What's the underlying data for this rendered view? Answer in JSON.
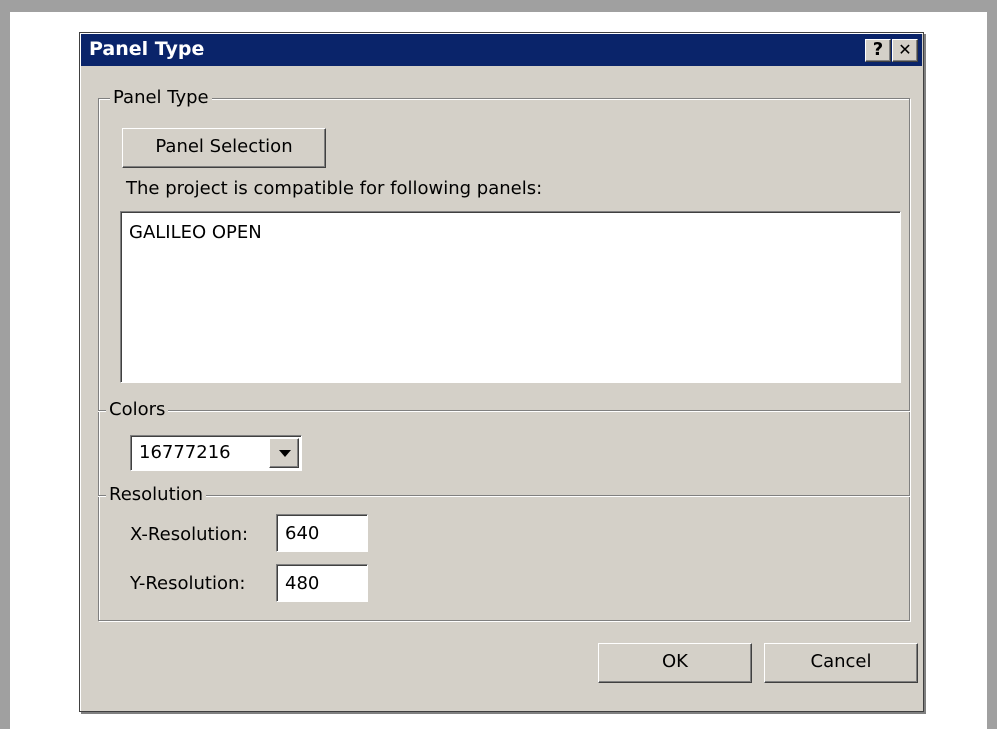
{
  "dialog": {
    "title": "Panel Type",
    "help_glyph": "?",
    "close_glyph": "✕"
  },
  "panel_type_group": {
    "label": "Panel Type",
    "selection_button": "Panel Selection",
    "compat_text": "The project is compatible for following panels:",
    "panels": [
      "GALILEO OPEN"
    ]
  },
  "colors_group": {
    "label": "Colors",
    "selected": "16777216"
  },
  "resolution_group": {
    "label": "Resolution",
    "x_label": "X-Resolution:",
    "x_value": "640",
    "y_label": "Y-Resolution:",
    "y_value": "480"
  },
  "buttons": {
    "ok": "OK",
    "cancel": "Cancel"
  },
  "icons": {
    "help": "help-icon",
    "close": "close-icon",
    "dropdown": "chevron-down-icon"
  }
}
